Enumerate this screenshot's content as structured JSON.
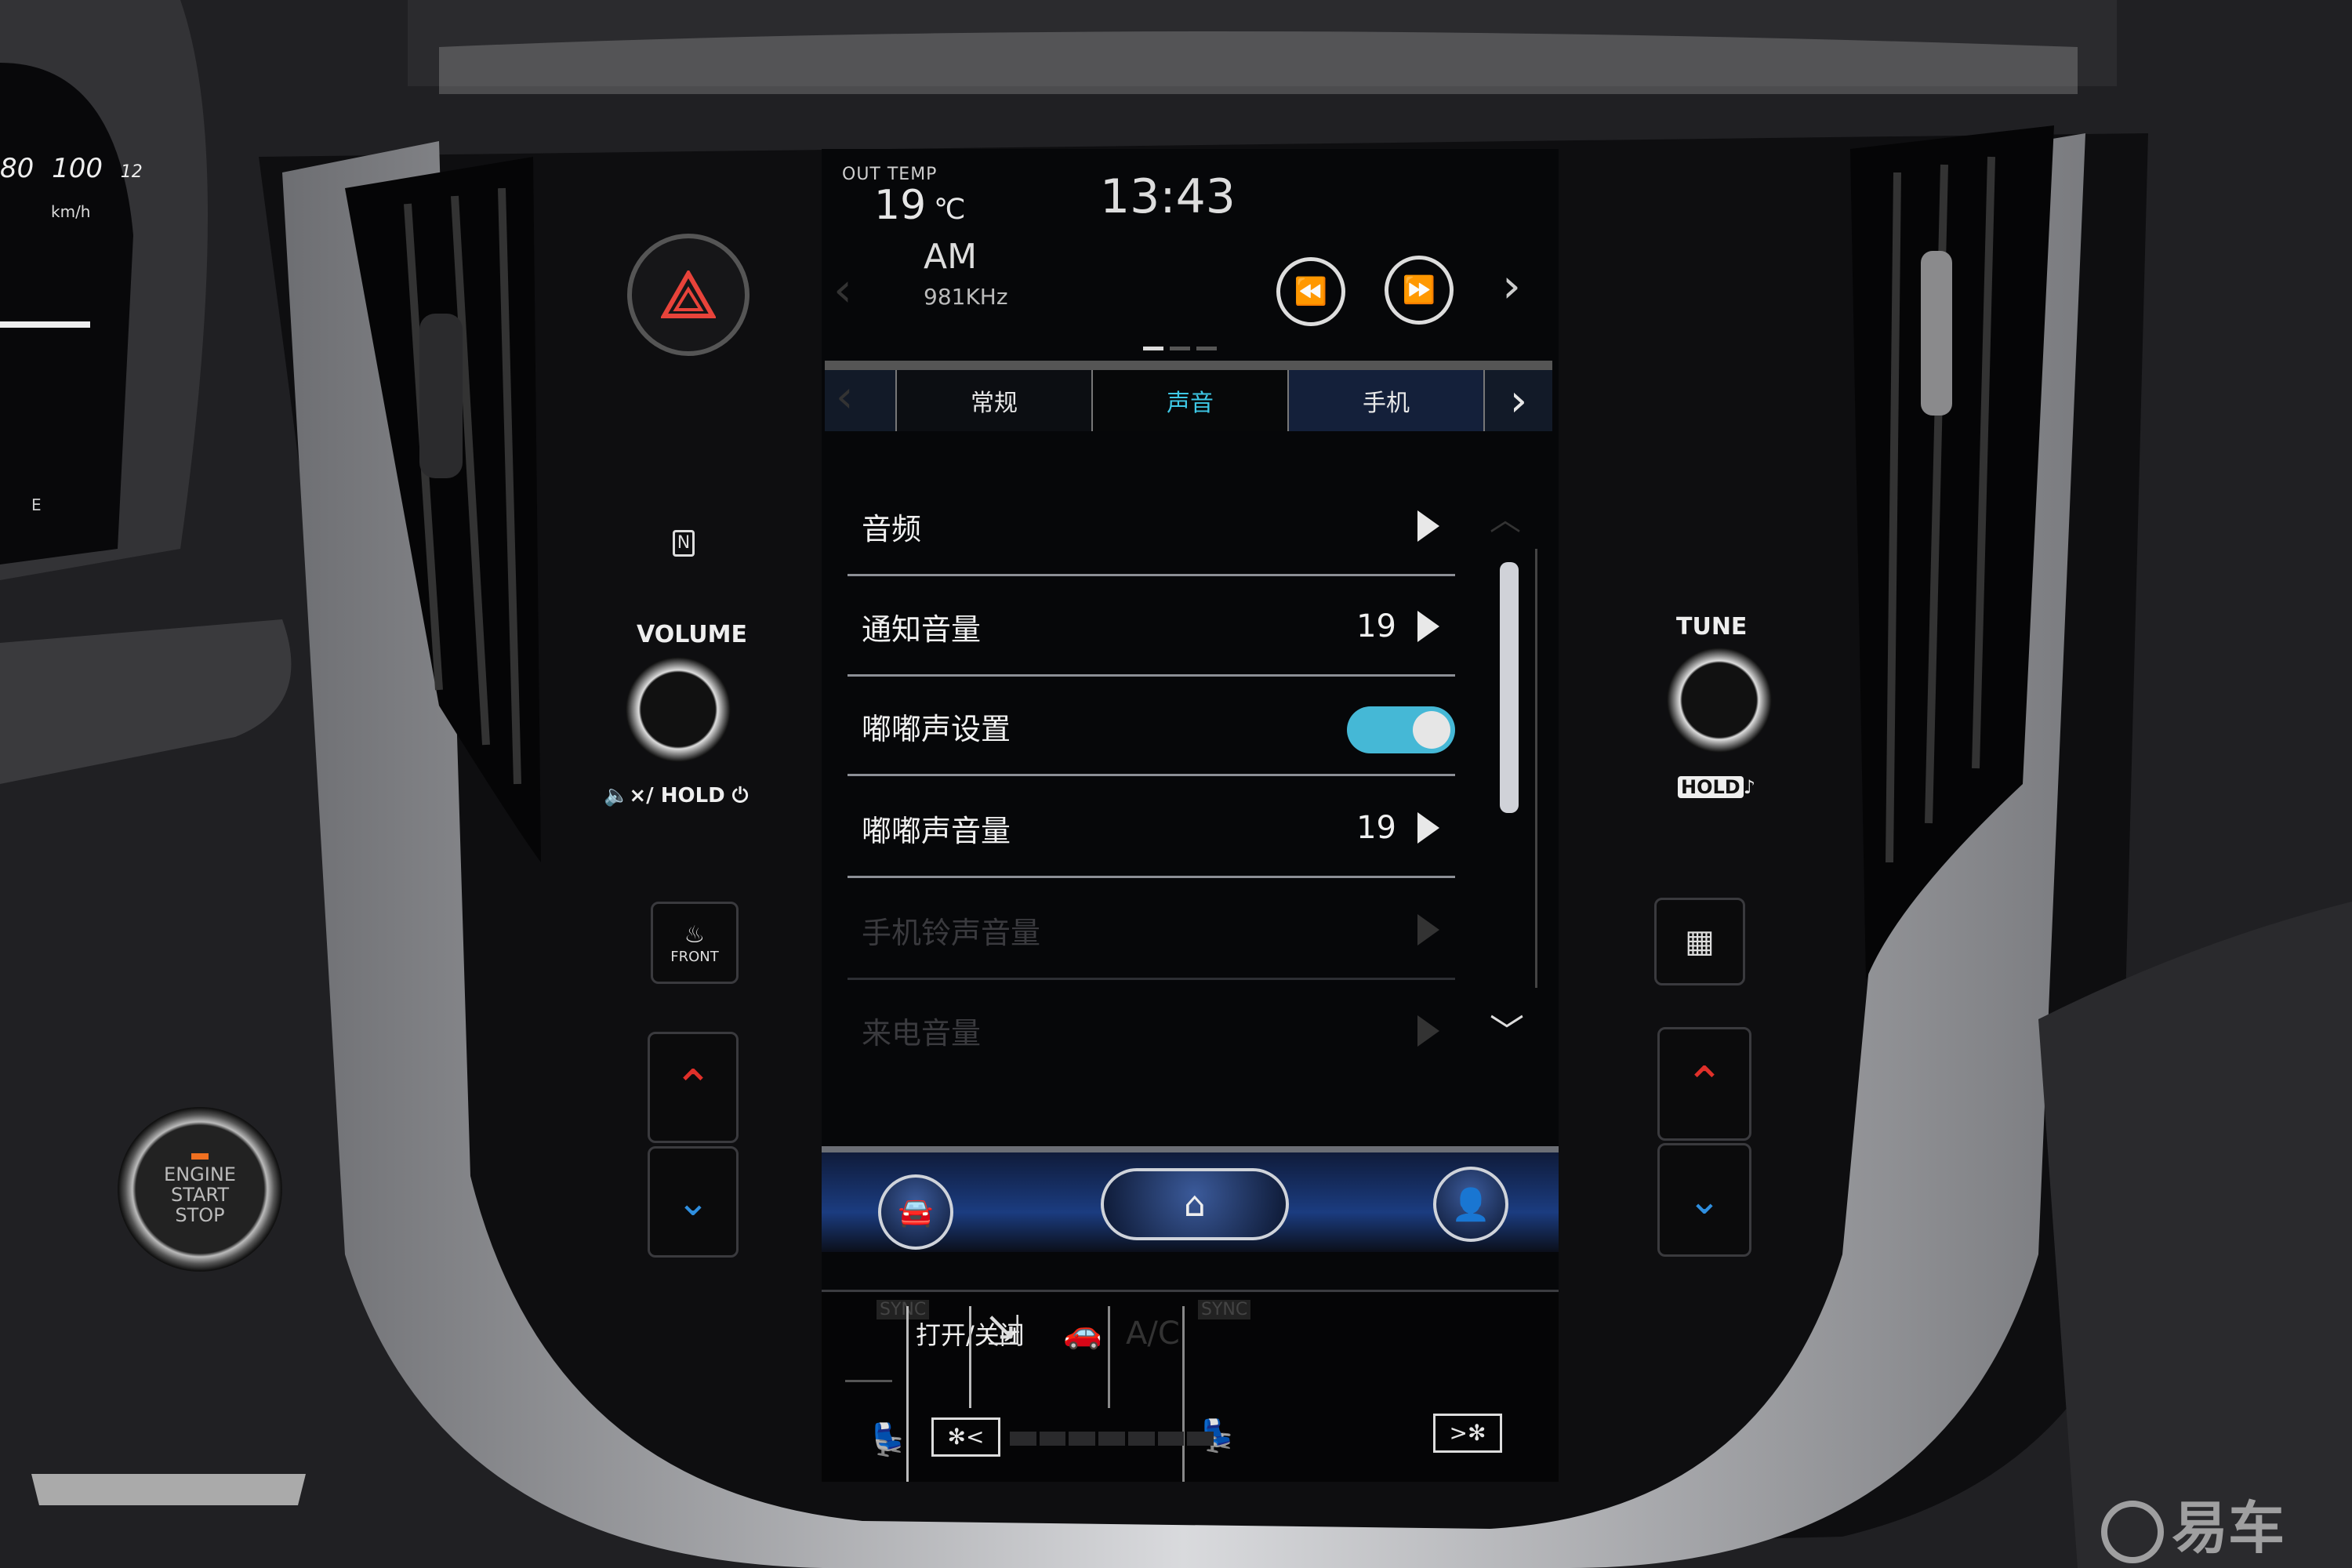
{
  "colors": {
    "accent": "#3ec8e6",
    "toggle_on": "#45b8d6",
    "hazard": "#e8433a",
    "arrow_up": "#e0302a",
    "arrow_down": "#2f8fe0"
  },
  "dashboard": {
    "speed_labels": [
      "80",
      "100",
      "12"
    ],
    "speed_unit": "km/h",
    "fuel_label": "E"
  },
  "header": {
    "out_temp_label": "OUT TEMP",
    "out_temp_value": "19",
    "out_temp_unit": "℃",
    "clock": "13:43"
  },
  "radio": {
    "band": "AM",
    "frequency": "981KHz",
    "icons": [
      "rewind-icon",
      "fast-forward-icon",
      "chevron-right-icon"
    ],
    "page_indicator": {
      "pages": 3,
      "active": 1
    }
  },
  "tabs": {
    "items": [
      {
        "label": "常规",
        "active": false
      },
      {
        "label": "声音",
        "active": true
      },
      {
        "label": "手机",
        "active": false
      }
    ]
  },
  "settings": {
    "items": [
      {
        "label": "音频",
        "value": "",
        "type": "submenu",
        "enabled": true
      },
      {
        "label": "通知音量",
        "value": "19",
        "type": "submenu",
        "enabled": true
      },
      {
        "label": "嘟嘟声设置",
        "value": "",
        "type": "toggle",
        "on": true,
        "enabled": true
      },
      {
        "label": "嘟嘟声音量",
        "value": "19",
        "type": "submenu",
        "enabled": true
      },
      {
        "label": "手机铃声音量",
        "value": "",
        "type": "submenu",
        "enabled": false
      },
      {
        "label": "来电音量",
        "value": "",
        "type": "submenu",
        "enabled": false
      }
    ]
  },
  "navbar": {
    "icons": [
      "car-icon",
      "home-icon",
      "user-icon"
    ]
  },
  "climate": {
    "sync_left": "SYNC",
    "sync_right": "SYNC",
    "power": "打开/关闭",
    "ac": "A/C",
    "fan_level": 0,
    "fan_segments": 7
  },
  "physical": {
    "volume": "VOLUME",
    "mute_hold": "×/ HOLD",
    "tune": "TUNE",
    "hold": "HOLD",
    "front": "FRONT",
    "engine": [
      "ENGINE",
      "START",
      "STOP"
    ]
  },
  "watermark": "易车"
}
